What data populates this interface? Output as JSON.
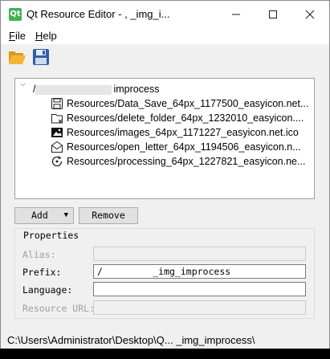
{
  "window": {
    "app_icon_text": "Qt",
    "title": "Qt Resource Editor - ,          _img_i...",
    "controls": [
      "minimize-icon",
      "maximize-icon",
      "close-icon"
    ]
  },
  "menu": {
    "file": "File",
    "help": "Help"
  },
  "toolbar": {
    "open_icon": "folder-open-icon",
    "save_icon": "floppy-disk-icon"
  },
  "tree": {
    "root_label": "improcess",
    "items": [
      {
        "icon": "save-icon",
        "label": "Resources/Data_Save_64px_1177500_easyicon.net..."
      },
      {
        "icon": "delete-folder-icon",
        "label": "Resources/delete_folder_64px_1232010_easyicon...."
      },
      {
        "icon": "image-icon",
        "label": "Resources/images_64px_1171227_easyicon.net.ico"
      },
      {
        "icon": "envelope-icon",
        "label": "Resources/open_letter_64px_1194506_easyicon.n..."
      },
      {
        "icon": "processing-icon",
        "label": "Resources/processing_64px_1227821_easyicon.ne..."
      }
    ]
  },
  "buttons": {
    "add": "Add",
    "remove": "Remove"
  },
  "properties": {
    "title": "Properties",
    "alias_label": "Alias:",
    "alias_value": "",
    "prefix_label": "Prefix:",
    "prefix_value": "/         _img_improcess",
    "language_label": "Language:",
    "language_value": "",
    "resource_url_label": "Resource URL:",
    "resource_url_value": ""
  },
  "status": {
    "text": "C:\\Users\\Administrator\\Desktop\\Q...    _img_improcess\\"
  },
  "colors": {
    "app_icon": "#41b153",
    "window_bg": "#f0f0f0"
  }
}
